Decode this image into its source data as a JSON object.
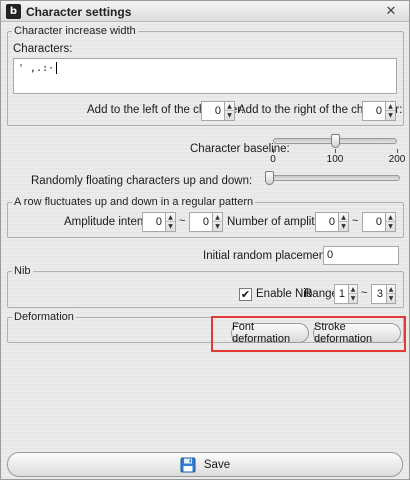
{
  "window": {
    "title": "Character settings",
    "app_icon": "app-logo-icon",
    "close_icon": "close-icon"
  },
  "increase_width": {
    "title": "Character increase width",
    "characters_label": "Characters:",
    "characters_value": "' ,.:·",
    "add_left_label": "Add to the left of the character:",
    "add_left_value": "0",
    "add_right_label": "Add to the right of the character:",
    "add_right_value": "0"
  },
  "baseline": {
    "label": "Character baseline:",
    "min": 0,
    "max": 200,
    "value": 100,
    "tick_labels": [
      "0",
      "100",
      "200"
    ]
  },
  "floating": {
    "label": "Randomly floating characters up and down:",
    "value": 0,
    "min": 0,
    "max": 100
  },
  "row_fluctuates": {
    "title": "A row fluctuates up and down in a regular pattern",
    "amplitude_label": "Amplitude intensity:",
    "amplitude_from": "0",
    "amplitude_to": "0",
    "count_label": "Number of amplitudes:",
    "count_from": "0",
    "count_to": "0",
    "range_separator": "~"
  },
  "initial_random": {
    "label": "Initial random placement (mm)",
    "value": "0"
  },
  "nib": {
    "title": "Nib",
    "enable_label": "Enable Nib",
    "enabled": true,
    "check_mark": "✔",
    "range_label": "Range:",
    "range_from": "1",
    "range_to": "3",
    "range_separator": "~"
  },
  "deformation": {
    "title": "Deformation",
    "font_button": "Font deformation",
    "stroke_button": "Stroke deformation"
  },
  "footer": {
    "save_label": "Save",
    "save_icon": "floppy-disk-icon"
  },
  "colors": {
    "highlight": "#e53935",
    "window_bg": "#e9e9e9"
  },
  "arrows": {
    "up": "▲",
    "down": "▼",
    "close": "✕"
  }
}
